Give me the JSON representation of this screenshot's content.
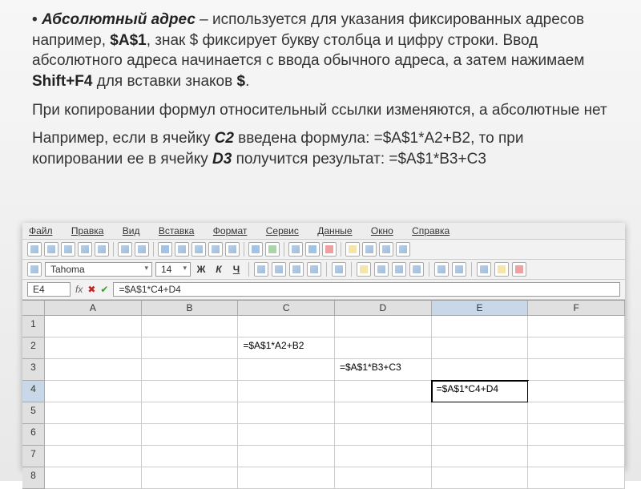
{
  "text": {
    "para1a": "Абсолютный адрес",
    "para1b": " – используется для указания фиксированных адресов например, ",
    "para1c": "$A$1",
    "para1d": ", знак $ фиксирует букву столбца и цифру строки. Ввод абсолютного адреса начинается с ввода обычного адреса, а затем нажимаем ",
    "para1e": "Shift+F4",
    "para1f": " для вставки знаков ",
    "para1g": "$",
    "para1h": ".",
    "para2": "При копировании формул относительный ссылки изменяются, а абсолютные нет",
    "para3a": "Например, если в ячейку ",
    "para3b": "С2",
    "para3c": " введена формула: =$A$1*A2+B2, то при копировании ее в ячейку ",
    "para3d": "D3",
    "para3e": " получится результат: =$A$1*B3+C3"
  },
  "menu": {
    "file": "Файл",
    "edit": "Правка",
    "view": "Вид",
    "insert": "Вставка",
    "format": "Формат",
    "tools": "Сервис",
    "data": "Данные",
    "window": "Окно",
    "help": "Справка"
  },
  "font": {
    "name": "Tahoma",
    "size": "14",
    "bold": "Ж",
    "italic": "К",
    "underline": "Ч"
  },
  "bar": {
    "ref": "E4",
    "fx": "fx",
    "formula": "=$A$1*C4+D4"
  },
  "cols": {
    "a": "A",
    "b": "B",
    "c": "C",
    "d": "D",
    "e": "E",
    "f": "F"
  },
  "rows": {
    "r1": "1",
    "r2": "2",
    "r3": "3",
    "r4": "4",
    "r5": "5",
    "r6": "6",
    "r7": "7",
    "r8": "8"
  },
  "cells": {
    "c2": "=$A$1*A2+B2",
    "d3": "=$A$1*B3+C3",
    "e4": "=$A$1*C4+D4"
  }
}
